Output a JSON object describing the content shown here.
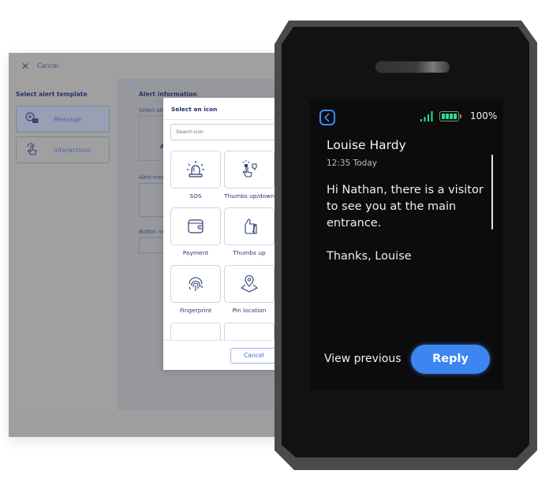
{
  "app": {
    "header": {
      "close_icon": "close-x-icon",
      "cancel_label": "Cancel"
    },
    "left_panel": {
      "title": "Select alert template",
      "templates": [
        {
          "label": "Message",
          "icon": "message-add-icon",
          "selected": true
        },
        {
          "label": "Interactions",
          "icon": "hand-tap-icon",
          "selected": false
        }
      ]
    },
    "right_panel": {
      "title": "Alert information",
      "select_icon_label": "Select ale",
      "dashed_box_text": "A",
      "alert_message_label": "Alert mes",
      "button_name_label": "Button na"
    }
  },
  "icon_modal": {
    "title": "Select an icon",
    "search_placeholder": "Search icon",
    "icons": [
      {
        "label": "SOS",
        "icon": "siren-icon"
      },
      {
        "label": "Thumbs up/down",
        "icon": "thumbs-up-down-icon"
      },
      {
        "label": "Payment",
        "icon": "wallet-icon"
      },
      {
        "label": "Thumbs up",
        "icon": "thumbs-up-icon"
      },
      {
        "label": "Fingerprint",
        "icon": "fingerprint-icon"
      },
      {
        "label": "Pin location",
        "icon": "map-pin-icon"
      },
      {
        "label": "",
        "icon": "fingerprint-partial-icon"
      },
      {
        "label": "",
        "icon": "location-partial-icon"
      }
    ],
    "cancel_label": "Cancel"
  },
  "phone": {
    "status": {
      "back_icon": "back-arrow-icon",
      "signal_icon": "signal-bars-icon",
      "battery_icon": "battery-icon",
      "battery_percent": "100%"
    },
    "message": {
      "sender": "Louise Hardy",
      "time": "12:35 Today",
      "body": "Hi Nathan, there is a visitor to see you at the main entrance.",
      "signoff": "Thanks, Louise"
    },
    "actions": {
      "view_previous": "View previous",
      "reply": "Reply"
    },
    "colors": {
      "accent": "#3d86f2",
      "battery": "#26e08a",
      "signal": "#26e08a"
    }
  }
}
